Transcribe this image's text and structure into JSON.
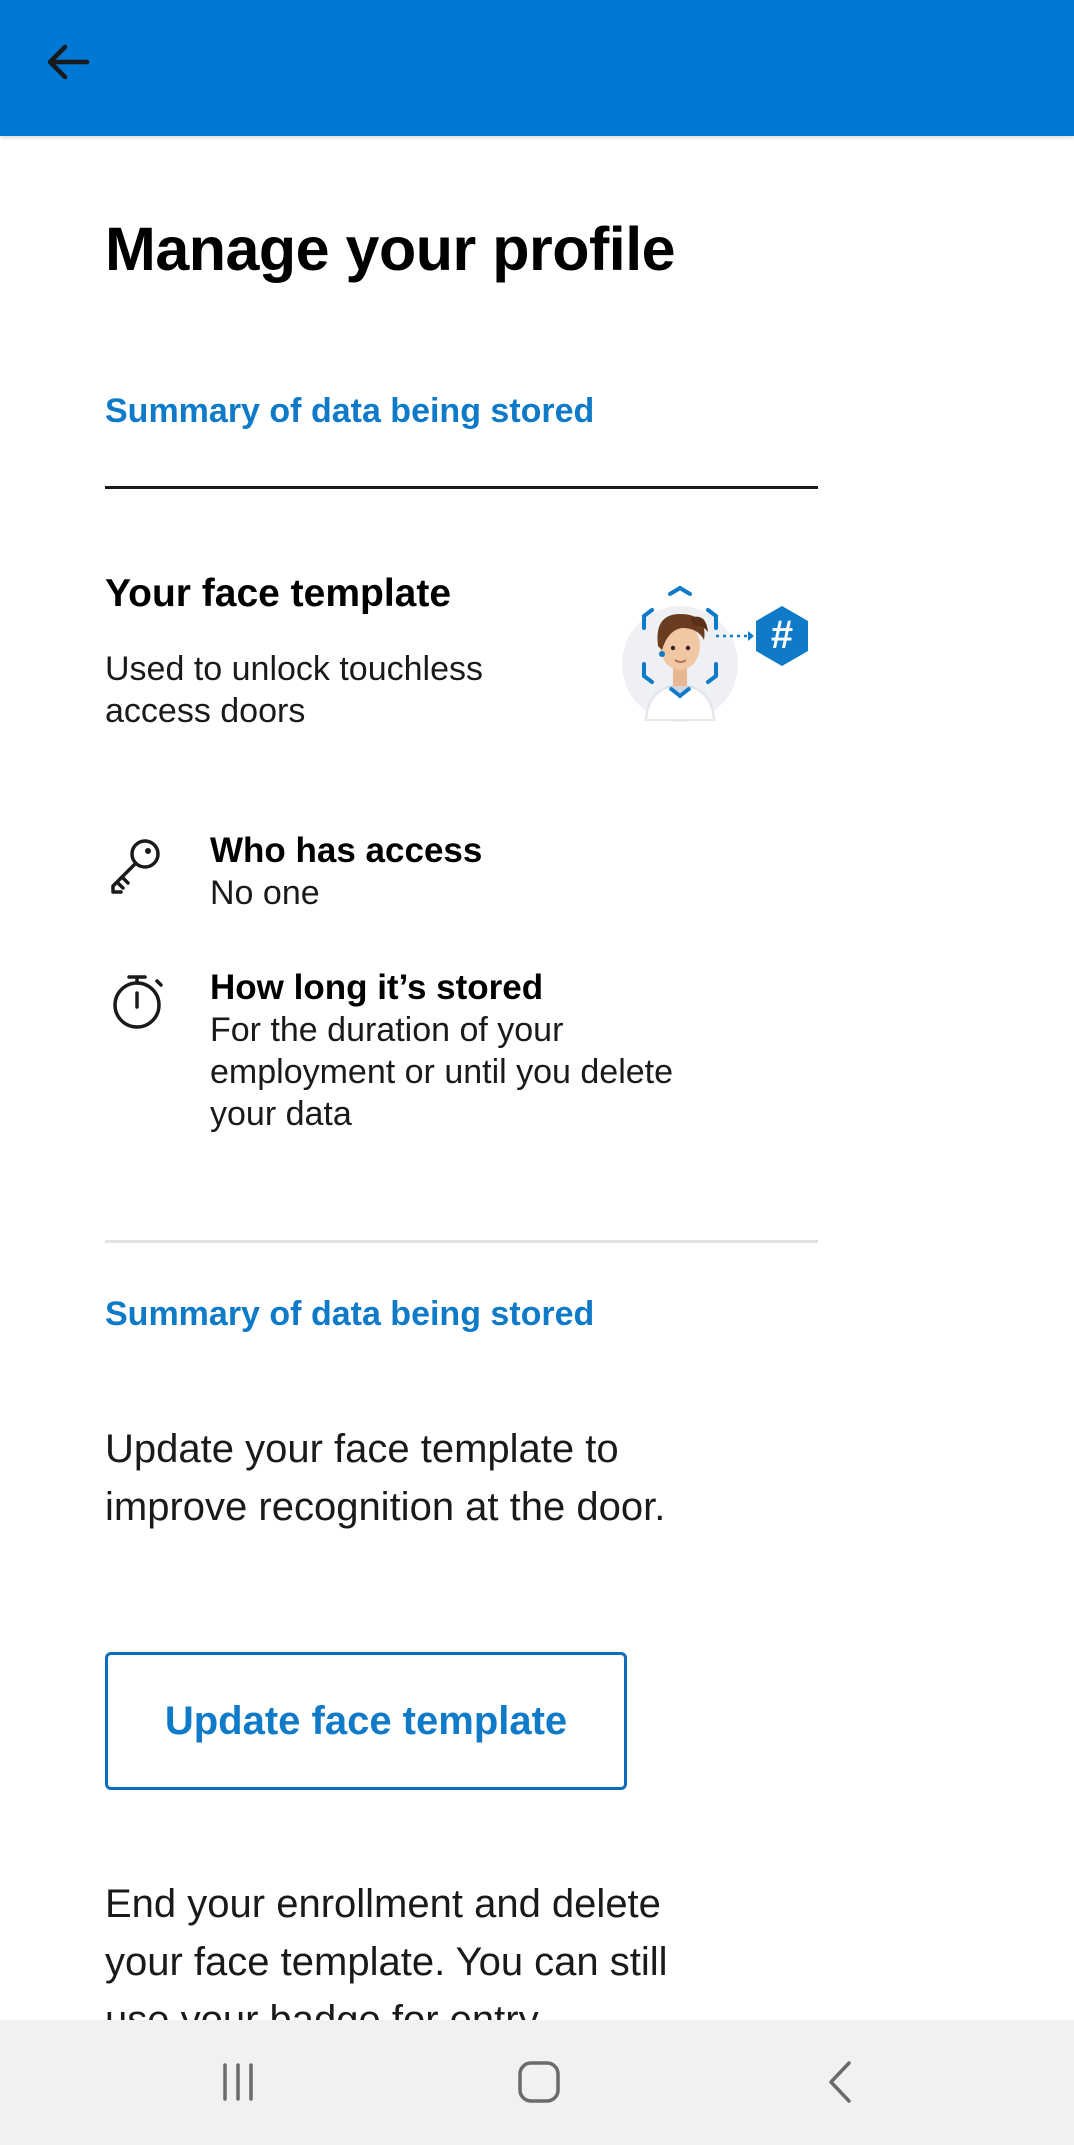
{
  "header": {
    "back_icon": "arrow-left-icon",
    "color": "#0078d4"
  },
  "page": {
    "title": "Manage your profile"
  },
  "sections": {
    "summary_label_1": "Summary of data being stored",
    "summary_label_2": "Summary of data being stored"
  },
  "face_template": {
    "title": "Your face template",
    "description": "Used to unlock touchless access doors",
    "illustration_icon": "face-scan-hash-icon"
  },
  "info_items": [
    {
      "icon": "key-icon",
      "title": "Who has access",
      "value": "No one"
    },
    {
      "icon": "stopwatch-icon",
      "title": "How long it’s stored",
      "value": "For the duration of your employment or until you delete your data"
    }
  ],
  "update": {
    "description": "Update your face template to improve recognition at the door.",
    "button_label": "Update face template"
  },
  "end_enrollment": {
    "description": "End your enrollment and delete your face template. You can still use your badge for entry."
  },
  "nav_bar": {
    "recents_icon": "recents-icon",
    "home_icon": "home-icon",
    "back_icon": "nav-back-icon"
  },
  "colors": {
    "accent": "#0f7bc8",
    "header": "#0078d4"
  }
}
